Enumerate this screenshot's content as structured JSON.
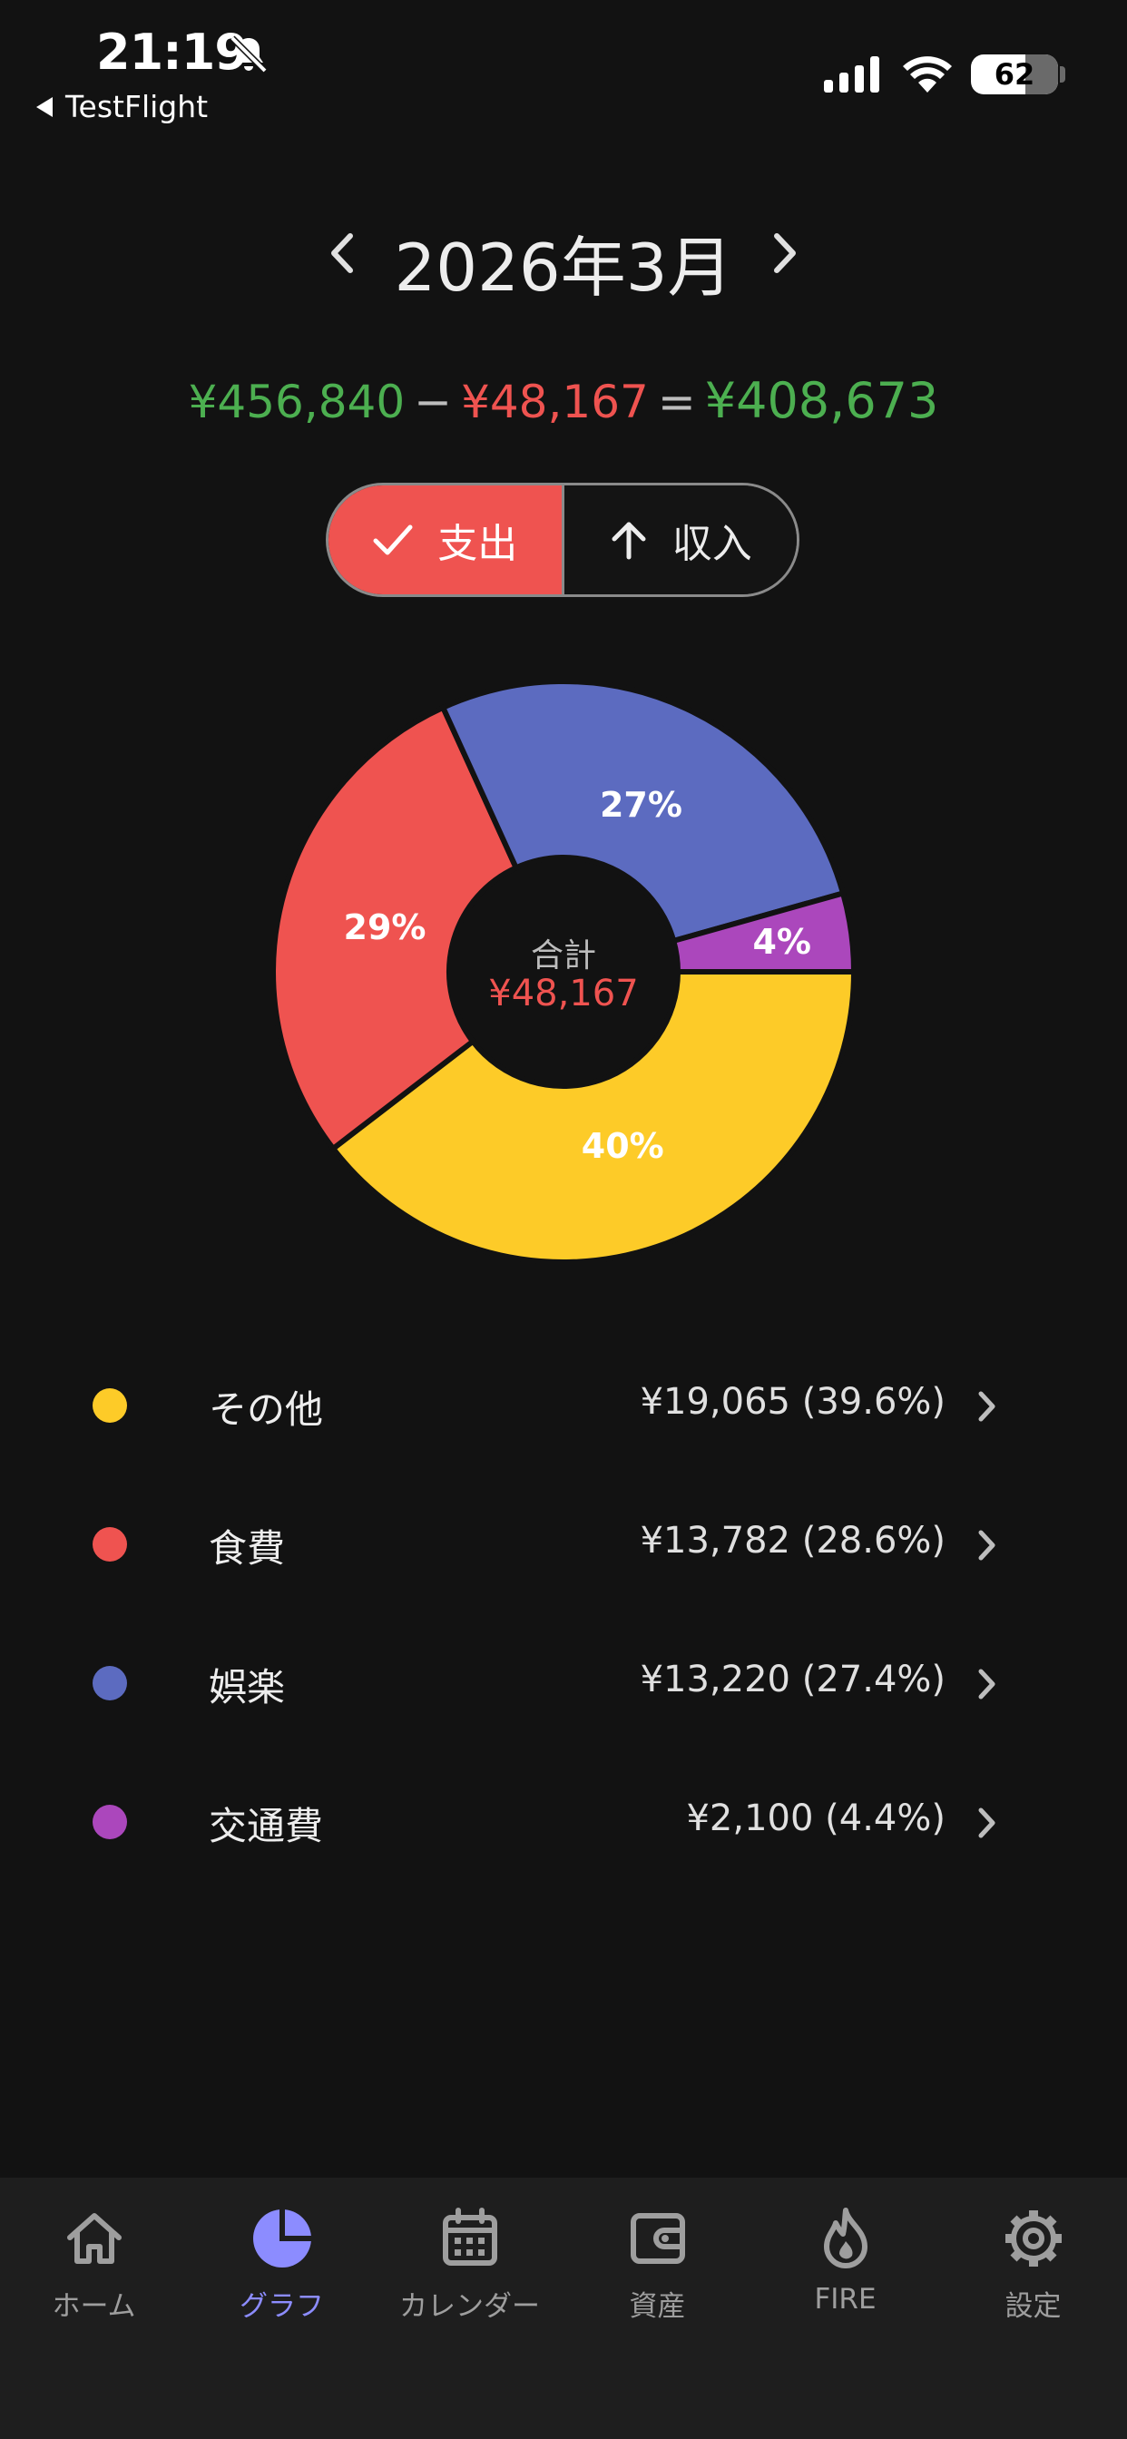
{
  "status_bar": {
    "time": "21:19",
    "back_app": "TestFlight",
    "battery_level": "62"
  },
  "header": {
    "month": "2026年3月"
  },
  "summary": {
    "income": "¥456,840",
    "minus": "−",
    "expense": "¥48,167",
    "equals": "=",
    "net": "¥408,673"
  },
  "toggle": {
    "expense_label": "支出",
    "income_label": "収入",
    "selected": "expense"
  },
  "chart_data": {
    "type": "pie",
    "donut": true,
    "center_label": "合計",
    "center_value": "¥48,167",
    "slices": [
      {
        "name": "その他",
        "value": 19065,
        "percent_label": "40%",
        "color": "#fdcb28"
      },
      {
        "name": "食費",
        "value": 13782,
        "percent_label": "29%",
        "color": "#ef5350"
      },
      {
        "name": "娯楽",
        "value": 13220,
        "percent_label": "27%",
        "color": "#5c6bc0"
      },
      {
        "name": "交通費",
        "value": 2100,
        "percent_label": "4%",
        "color": "#ab47bc"
      }
    ]
  },
  "categories": [
    {
      "name": "その他",
      "amount": "¥19,065",
      "percent": "(39.6%)",
      "color": "#fdcb28"
    },
    {
      "name": "食費",
      "amount": "¥13,782",
      "percent": "(28.6%)",
      "color": "#ef5350"
    },
    {
      "name": "娯楽",
      "amount": "¥13,220",
      "percent": "(27.4%)",
      "color": "#5c6bc0"
    },
    {
      "name": "交通費",
      "amount": "¥2,100",
      "percent": "(4.4%)",
      "color": "#ab47bc"
    }
  ],
  "tabs": [
    {
      "label": "ホーム",
      "icon": "home-icon"
    },
    {
      "label": "グラフ",
      "icon": "pie-chart-icon"
    },
    {
      "label": "カレンダー",
      "icon": "calendar-icon"
    },
    {
      "label": "資産",
      "icon": "wallet-icon"
    },
    {
      "label": "FIRE",
      "icon": "flame-icon"
    },
    {
      "label": "設定",
      "icon": "gear-icon"
    }
  ],
  "active_tab": "グラフ",
  "colors": {
    "background": "#121212",
    "income": "#4caf50",
    "expense": "#ef5350",
    "active_tab": "#8c8cff"
  }
}
